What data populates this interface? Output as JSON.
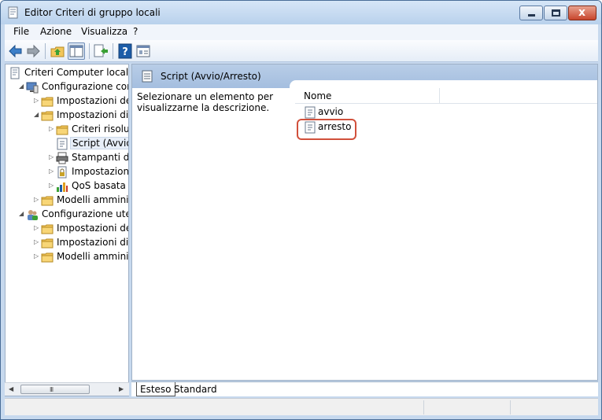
{
  "window": {
    "title": "Editor Criteri di gruppo locali",
    "close_glyph": "x"
  },
  "menu": {
    "items": [
      "File",
      "Azione",
      "Visualizza",
      "?"
    ]
  },
  "toolbar": {
    "buttons": [
      {
        "icon": "back-arrow-icon"
      },
      {
        "icon": "forward-arrow-icon"
      },
      {
        "icon": "up-folder-icon"
      },
      {
        "icon": "show-hide-tree-icon"
      },
      {
        "icon": "export-list-icon"
      },
      {
        "icon": "help-icon"
      },
      {
        "icon": "properties-icon"
      }
    ]
  },
  "tree": {
    "items": [
      {
        "label": "Criteri Computer locale",
        "icon": "policy-document-icon",
        "level": 0,
        "expander": ""
      },
      {
        "label": "Configurazione com",
        "icon": "computer-icon",
        "level": 1,
        "expander": "expanded"
      },
      {
        "label": "Impostazioni del",
        "icon": "folder-icon",
        "level": 2,
        "expander": "collapsed"
      },
      {
        "label": "Impostazioni di W",
        "icon": "folder-icon",
        "level": 2,
        "expander": "expanded"
      },
      {
        "label": "Criteri risoluzi",
        "icon": "folder-icon",
        "level": 3,
        "expander": "collapsed"
      },
      {
        "label": "Script (Avvio/",
        "icon": "script-icon",
        "level": 3,
        "expander": "",
        "selected": true
      },
      {
        "label": "Stampanti dis",
        "icon": "printer-icon",
        "level": 3,
        "expander": "collapsed"
      },
      {
        "label": "Impostazioni",
        "icon": "security-settings-icon",
        "level": 3,
        "expander": "collapsed"
      },
      {
        "label": "QoS basata su",
        "icon": "qos-chart-icon",
        "level": 3,
        "expander": "collapsed"
      },
      {
        "label": "Modelli amminis",
        "icon": "folder-icon",
        "level": 2,
        "expander": "collapsed"
      },
      {
        "label": "Configurazione uten",
        "icon": "users-icon",
        "level": 1,
        "expander": "expanded"
      },
      {
        "label": "Impostazioni del",
        "icon": "folder-icon",
        "level": 2,
        "expander": "collapsed"
      },
      {
        "label": "Impostazioni di W",
        "icon": "folder-icon",
        "level": 2,
        "expander": "collapsed"
      },
      {
        "label": "Modelli amminis",
        "icon": "folder-icon",
        "level": 2,
        "expander": "collapsed"
      }
    ]
  },
  "hscroll": {
    "left_arrow": "◀",
    "right_arrow": "▶",
    "grip": "III"
  },
  "content": {
    "header_title": "Script (Avvio/Arresto)",
    "description": "Selezionare un elemento per visualizzarne la descrizione.",
    "column_name": "Nome",
    "items": [
      {
        "label": "avvio",
        "icon": "script-icon"
      },
      {
        "label": "arresto",
        "icon": "script-icon"
      }
    ]
  },
  "tabs": {
    "extended": "Esteso",
    "standard": "Standard"
  },
  "colors": {
    "accent": "#1c5ca8",
    "highlight_ring": "#d1503b",
    "folder": "#f2c65a"
  }
}
